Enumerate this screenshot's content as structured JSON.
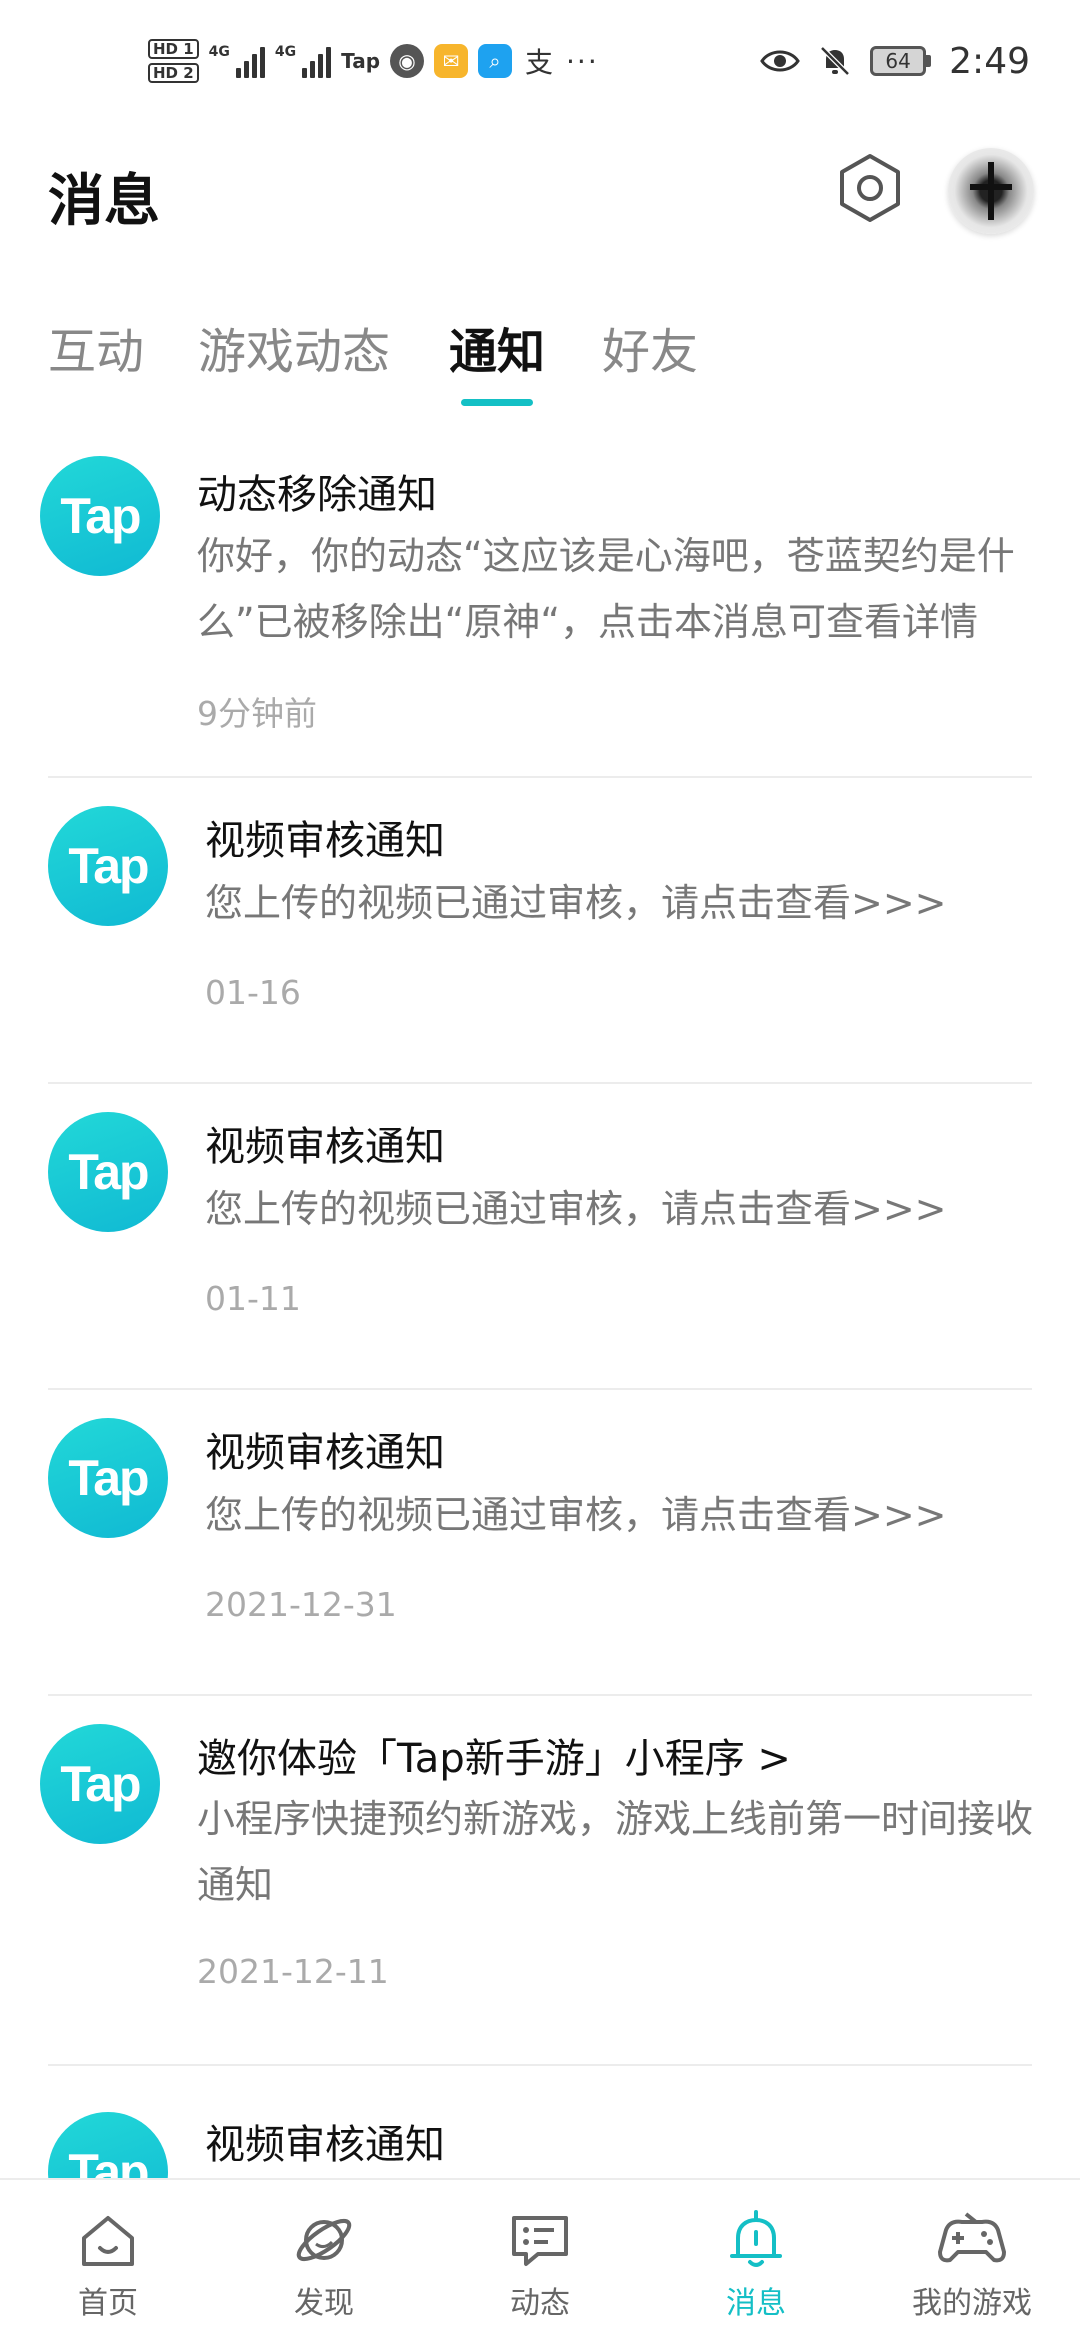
{
  "status_bar": {
    "hd1": "HD 1",
    "hd2": "HD 2",
    "net1": "4G",
    "net2": "4G",
    "tap_label": "Tap",
    "alipay_glyph": "支",
    "more": "···",
    "battery": "64",
    "time": "2:49",
    "icons": [
      "eye-icon",
      "bell-off-icon",
      "battery-icon"
    ]
  },
  "header": {
    "title": "消息",
    "settings_icon": "gear-icon"
  },
  "tabs": [
    {
      "label": "互动",
      "active": false
    },
    {
      "label": "游戏动态",
      "active": false
    },
    {
      "label": "通知",
      "active": true
    },
    {
      "label": "好友",
      "active": false
    }
  ],
  "accent_color": "#14c0c5",
  "logo_text": "Tap",
  "notifications": [
    {
      "title": "动态移除通知",
      "body": "你好，你的动态“这应该是心海吧，苍蓝契约是什么”已被移除出“原神“，点击本消息可查看详情",
      "time": "9分钟前"
    },
    {
      "title": "视频审核通知",
      "body": "您上传的视频已通过审核，请点击查看>>>",
      "time": "01-16"
    },
    {
      "title": "视频审核通知",
      "body": "您上传的视频已通过审核，请点击查看>>>",
      "time": "01-11"
    },
    {
      "title": "视频审核通知",
      "body": "您上传的视频已通过审核，请点击查看>>>",
      "time": "2021-12-31"
    },
    {
      "title": "邀你体验「Tap新手游」小程序 >",
      "body": "小程序快捷预约新游戏，游戏上线前第一时间接收通知",
      "time": "2021-12-11"
    },
    {
      "title": "视频审核通知"
    }
  ],
  "bottom_nav": [
    {
      "label": "首页",
      "icon": "home-icon",
      "active": false
    },
    {
      "label": "发现",
      "icon": "planet-icon",
      "active": false
    },
    {
      "label": "动态",
      "icon": "message-icon",
      "active": false
    },
    {
      "label": "消息",
      "icon": "bell-icon",
      "active": true
    },
    {
      "label": "我的游戏",
      "icon": "gamepad-icon",
      "active": false
    }
  ]
}
